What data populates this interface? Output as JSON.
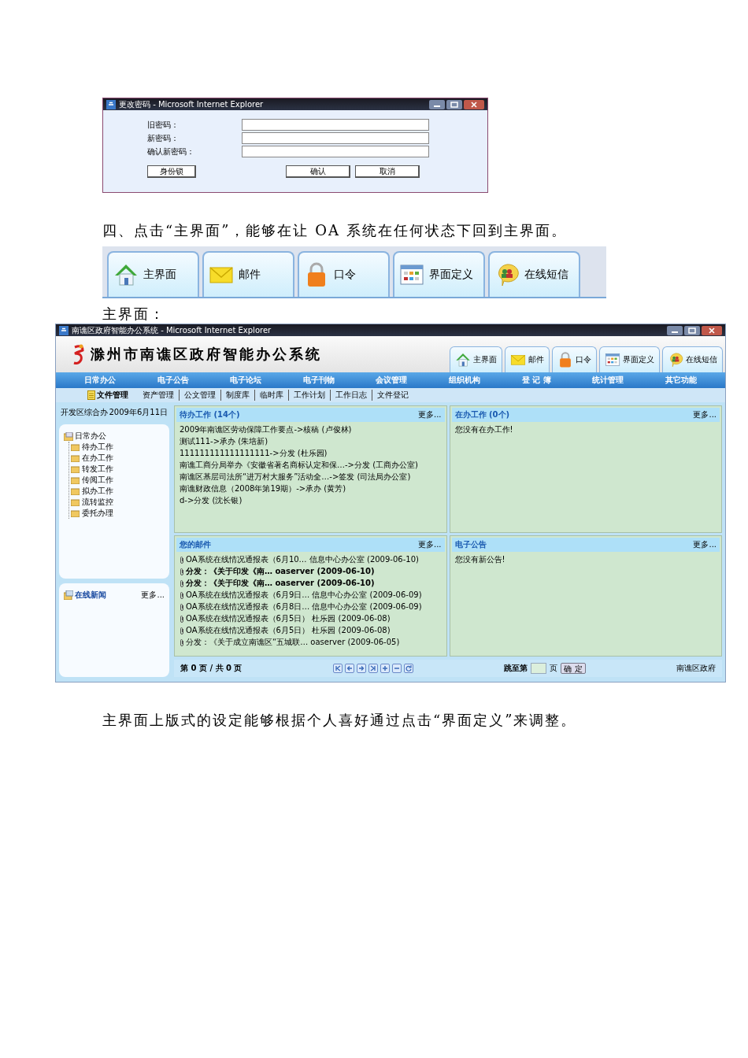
{
  "password_dialog": {
    "title": "更改密码 - Microsoft Internet Explorer",
    "fields": [
      {
        "label": "旧密码："
      },
      {
        "label": "新密码："
      },
      {
        "label": "确认新密码："
      }
    ],
    "buttons": [
      "身份锁",
      "确认",
      "取消"
    ]
  },
  "paragraph_1": "四、点击“主界面”，能够在让 OA 系统在任何状态下回到主界面。",
  "toolbar": {
    "tabs": [
      {
        "label": "主界面",
        "kind": "house"
      },
      {
        "label": "邮件",
        "kind": "mail"
      },
      {
        "label": "口令",
        "kind": "lock"
      },
      {
        "label": "界面定义",
        "kind": "layout"
      },
      {
        "label": "在线短信",
        "kind": "chat"
      }
    ]
  },
  "caption": "主界面：",
  "main_window": {
    "title": "南谯区政府智能办公系统 - Microsoft Internet Explorer",
    "banner_title": "滁州市南谯区政府智能办公系统",
    "tabs": [
      {
        "label": "主界面",
        "kind": "house"
      },
      {
        "label": "邮件",
        "kind": "mail"
      },
      {
        "label": "口令",
        "kind": "lock"
      },
      {
        "label": "界面定义",
        "kind": "layout"
      },
      {
        "label": "在线短信",
        "kind": "chat"
      }
    ],
    "menu": [
      "日常办公",
      "电子公告",
      "电子论坛",
      "电子刊物",
      "会议管理",
      "组织机构",
      "登 记 簿",
      "统计管理",
      "其它功能"
    ],
    "submenu": {
      "current": "文件管理",
      "items": [
        "资产管理",
        "公文管理",
        "制度库",
        "临时库",
        "工作计划",
        "工作日志",
        "文件登记"
      ]
    },
    "department": "开发区综合办",
    "date": "2009年6月11日",
    "tree": {
      "label": "日常办公",
      "children": [
        {
          "label": "待办工作"
        },
        {
          "label": "在办工作"
        },
        {
          "label": "转发工作"
        },
        {
          "label": "传阅工作"
        },
        {
          "label": "拟办工作"
        },
        {
          "label": "流转监控"
        },
        {
          "label": "委托办理"
        }
      ]
    },
    "news": {
      "title": "在线新闻",
      "more": "更多..."
    },
    "panels": [
      {
        "title": "待办工作 (14个)",
        "more": "更多...",
        "items": [
          {
            "text": "2009年南谯区劳动保障工作要点->核稿 (卢俊林)",
            "bold": false,
            "attachment": false
          },
          {
            "text": "测试111->承办 (朱培新)",
            "bold": false,
            "attachment": false
          },
          {
            "text": "111111111111111111->分发 (杜乐园)",
            "bold": false,
            "attachment": false
          },
          {
            "text": "南谯工商分局举办《安徽省著名商标认定和保…->分发 (工商办公室)",
            "bold": false,
            "attachment": false
          },
          {
            "text": "南谯区基层司法所“进万村大服务”活动全…->签发 (司法局办公室)",
            "bold": false,
            "attachment": false
          },
          {
            "text": "南谯财政信息（2008年第19期）->承办 (黄芳)",
            "bold": false,
            "attachment": false
          },
          {
            "text": "d->分发 (沈长银)",
            "bold": false,
            "attachment": false
          }
        ]
      },
      {
        "title": "在办工作 (0个)",
        "more": "更多...",
        "items": [
          {
            "text": "您没有在办工作!",
            "bold": false,
            "attachment": false
          }
        ]
      },
      {
        "title": "您的邮件",
        "more": "更多...",
        "items": [
          {
            "text": "OA系统在线情况通报表（6月10… 信息中心办公室 (2009-06-10)",
            "bold": false,
            "attachment": true
          },
          {
            "text": "分发：《关于印发《南… oaserver (2009-06-10)",
            "bold": true,
            "attachment": true
          },
          {
            "text": "分发：《关于印发《南… oaserver (2009-06-10)",
            "bold": true,
            "attachment": true
          },
          {
            "text": "OA系统在线情况通报表（6月9日… 信息中心办公室 (2009-06-09)",
            "bold": false,
            "attachment": true
          },
          {
            "text": "OA系统在线情况通报表（6月8日… 信息中心办公室 (2009-06-09)",
            "bold": false,
            "attachment": true
          },
          {
            "text": "OA系统在线情况通报表（6月5日） 杜乐园 (2009-06-08)",
            "bold": false,
            "attachment": true
          },
          {
            "text": "OA系统在线情况通报表（6月5日） 杜乐园 (2009-06-08)",
            "bold": false,
            "attachment": true
          },
          {
            "text": "分发：《关于成立南谯区“五城联… oaserver (2009-06-05)",
            "bold": false,
            "attachment": true
          }
        ]
      },
      {
        "title": "电子公告",
        "more": "更多...",
        "items": [
          {
            "text": "您没有新公告!",
            "bold": false,
            "attachment": false
          }
        ]
      }
    ],
    "pager": {
      "status": "第 0 页 / 共 0 页",
      "goto_label": "跳至第",
      "page_unit": "页",
      "confirm": "确 定",
      "footer": "南谯区政府"
    }
  },
  "paragraph_2": "主界面上版式的设定能够根据个人喜好通过点击“界面定义”来调整。"
}
